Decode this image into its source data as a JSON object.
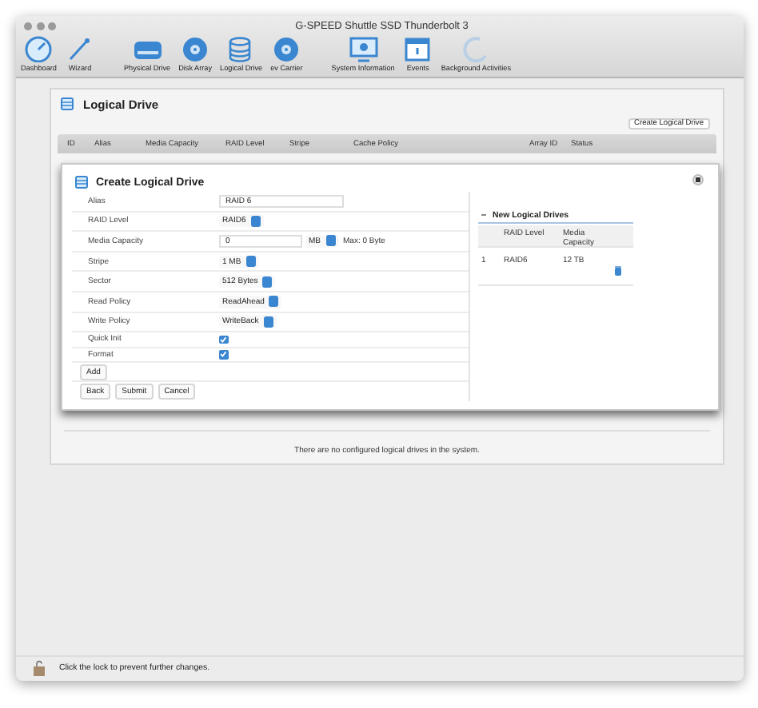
{
  "window": {
    "title": "G-SPEED Shuttle SSD Thunderbolt 3"
  },
  "toolbar_groups": [
    [
      {
        "label": "Dashboard"
      },
      {
        "label": "Wizard"
      }
    ],
    [
      {
        "label": "Physical Drive"
      },
      {
        "label": "Disk Array"
      },
      {
        "label": "Logical Drive"
      },
      {
        "label": "ev Carrier"
      }
    ],
    [
      {
        "label": "System Information"
      },
      {
        "label": "Events"
      },
      {
        "label": "Background Activities"
      }
    ]
  ],
  "page": {
    "title": "Logical Drive",
    "create_button": "Create Logical Drive",
    "columns": [
      "ID",
      "Alias",
      "Media Capacity",
      "RAID Level",
      "Stripe",
      "Cache Policy",
      "Array ID",
      "Status"
    ],
    "empty_message": "There are no configured logical drives in the system."
  },
  "dialog": {
    "title": "Create Logical Drive",
    "fields": [
      {
        "label": "Alias",
        "kind": "text",
        "value": "RAID 6"
      },
      {
        "label": "RAID Level",
        "kind": "select",
        "value": "RAID6"
      },
      {
        "label": "Media Capacity",
        "kind": "capacity",
        "value": "0",
        "unit": "MB",
        "max": "Max: 0 Byte"
      },
      {
        "label": "Stripe",
        "kind": "select",
        "value": "1 MB"
      },
      {
        "label": "Sector",
        "kind": "select",
        "value": "512 Bytes"
      },
      {
        "label": "Read Policy",
        "kind": "select",
        "value": "ReadAhead"
      },
      {
        "label": "Write Policy",
        "kind": "select",
        "value": "WriteBack"
      },
      {
        "label": "Quick Init",
        "kind": "checkbox",
        "checked": true
      },
      {
        "label": "Format",
        "kind": "checkbox",
        "checked": true
      }
    ],
    "add_button": "Add",
    "buttons": [
      "Back",
      "Submit",
      "Cancel"
    ],
    "new_drives": {
      "title": "New Logical Drives",
      "columns": [
        "RAID Level",
        "Media Capacity"
      ],
      "rows": [
        {
          "id": "1",
          "raid_level": "RAID6",
          "capacity": "12 TB"
        }
      ]
    }
  },
  "status_bar": {
    "text": "Click the lock to prevent further changes."
  }
}
